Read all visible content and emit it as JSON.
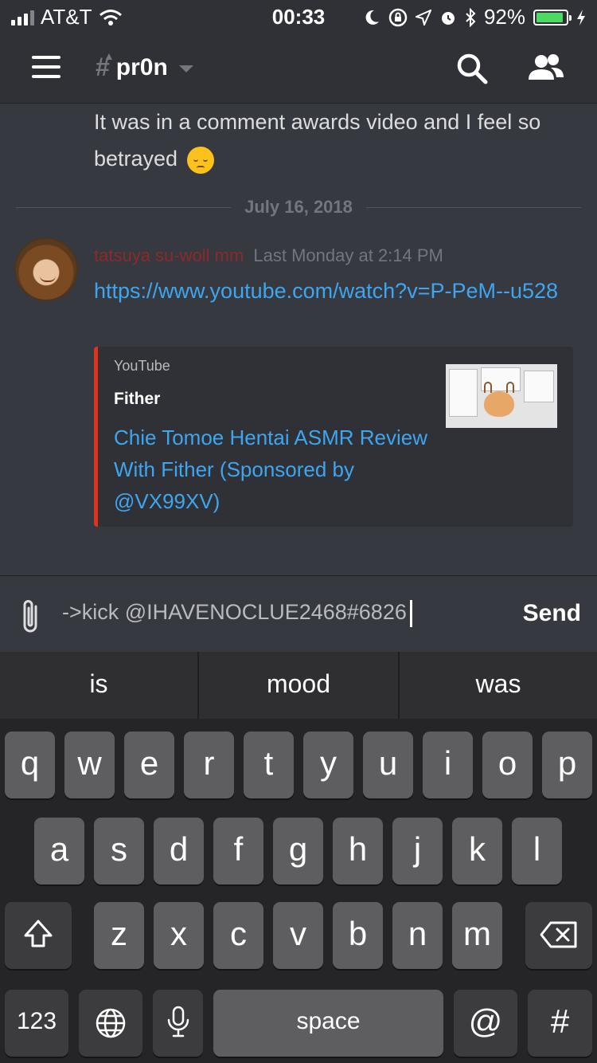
{
  "status_bar": {
    "carrier": "AT&T",
    "time": "00:33",
    "battery_percent": "92%",
    "battery_level": 0.92
  },
  "header": {
    "channel_name": "pr0n"
  },
  "messages": {
    "prev_text": "It was in a comment awards video and I feel so betrayed",
    "date_divider": "July 16, 2018",
    "author": "tatsuya su-woll mm",
    "timestamp": "Last Monday at 2:14 PM",
    "link": "https://www.youtube.com/watch?v=P-PeM--u528",
    "embed": {
      "provider": "YouTube",
      "author": "Fither",
      "title": "Chie Tomoe Hentai ASMR Review With Fither (Sponsored by @VX99XV)"
    }
  },
  "composer": {
    "input_value": "->kick @IHAVENOCLUE2468#6826",
    "send_label": "Send"
  },
  "keyboard": {
    "suggestions": [
      "is",
      "mood",
      "was"
    ],
    "row1": [
      "q",
      "w",
      "e",
      "r",
      "t",
      "y",
      "u",
      "i",
      "o",
      "p"
    ],
    "row2": [
      "a",
      "s",
      "d",
      "f",
      "g",
      "h",
      "j",
      "k",
      "l"
    ],
    "row3": [
      "z",
      "x",
      "c",
      "v",
      "b",
      "n",
      "m"
    ],
    "numbers_label": "123",
    "space_label": "space",
    "at_label": "@",
    "hash_label": "#"
  },
  "colors": {
    "background": "#36393f",
    "header": "#2f3136",
    "link": "#3ea6f0",
    "embed_border": "#e0321f",
    "author": "#8b2a2a"
  }
}
